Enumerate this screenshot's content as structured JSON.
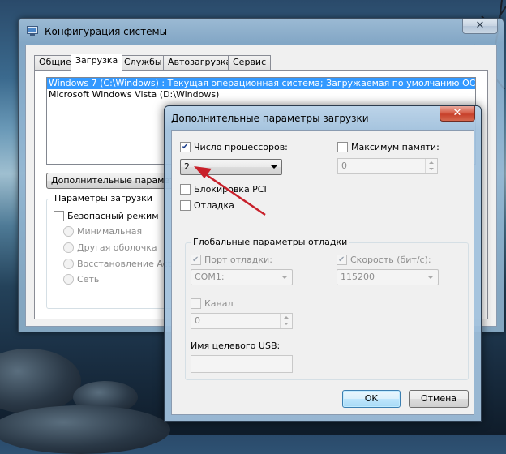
{
  "main_window": {
    "title": "Конфигурация системы",
    "close_glyph": "✕",
    "tabs": [
      "Общие",
      "Загрузка",
      "Службы",
      "Автозагрузка",
      "Сервис"
    ],
    "active_tab": "Загрузка",
    "os_list": [
      "Windows 7 (C:\\Windows) : Текущая операционная система; Загружаемая по умолчанию ОС",
      "Microsoft Windows Vista (D:\\Windows)"
    ],
    "advanced_button": "Дополнительные параметры...",
    "boot_options": {
      "legend": "Параметры загрузки",
      "safe_mode": "Безопасный режим",
      "radios": [
        "Минимальная",
        "Другая оболочка",
        "Восстановление Active Directory",
        "Сеть"
      ]
    }
  },
  "dialog": {
    "title": "Дополнительные параметры загрузки",
    "close_glyph": "✕",
    "num_processors": {
      "label": "Число процессоров:",
      "checked": true,
      "value": "2"
    },
    "max_memory": {
      "label": "Максимум памяти:",
      "checked": false,
      "value": "0"
    },
    "pci_lock": {
      "label": "Блокировка PCI",
      "checked": false
    },
    "debug": {
      "label": "Отладка",
      "checked": false
    },
    "debug_settings": {
      "legend": "Глобальные параметры отладки",
      "debug_port": {
        "label": "Порт отладки:",
        "checked": true,
        "value": "COM1:"
      },
      "baud_rate": {
        "label": "Скорость (бит/с):",
        "checked": true,
        "value": "115200"
      },
      "channel": {
        "label": "Канал",
        "checked": false,
        "value": "0"
      },
      "usb_target": {
        "label": "Имя целевого USB:",
        "value": ""
      }
    },
    "ok_button": "ОК",
    "cancel_button": "Отмена"
  },
  "colors": {
    "selection": "#3399ff",
    "annotation_arrow": "#c8202a",
    "dialog_close": "#c7402a"
  }
}
